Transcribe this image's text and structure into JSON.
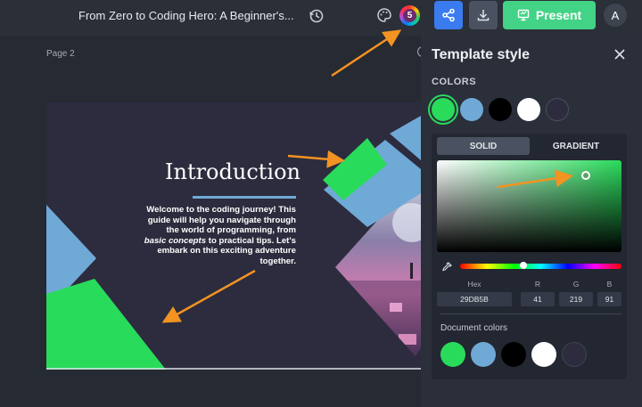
{
  "topbar": {
    "doc_title": "From Zero to Coding Hero: A Beginner's...",
    "color_badge": "5",
    "present_label": "Present",
    "avatar_initial": "A"
  },
  "canvas": {
    "page_label": "Page 2",
    "slide": {
      "title": "Introduction",
      "body_pre": "Welcome to the coding journey! This guide will help you navigate through the world of programming, from ",
      "body_em": "basic concepts",
      "body_post": " to practical tips. Let's embark on this exciting adventure together."
    }
  },
  "panel": {
    "title": "Template style",
    "colors_label": "COLORS",
    "swatches": [
      "#29db5b",
      "#6fa9d6",
      "#000000",
      "#ffffff",
      "#2c2c3e"
    ],
    "tabs": {
      "solid": "SOLID",
      "gradient": "GRADIENT"
    },
    "fields": {
      "hex_label": "Hex",
      "hex": "29DB5B",
      "r_label": "R",
      "r": "41",
      "g_label": "G",
      "g": "219",
      "b_label": "B",
      "b": "91"
    },
    "doc_colors_label": "Document colors",
    "doc_colors": [
      "#29db5b",
      "#6fa9d6",
      "#000000",
      "#ffffff",
      "#2c2c3e"
    ]
  },
  "colors": {
    "accent_green": "#43d386",
    "share_blue": "#3a7bf0",
    "annotation_orange": "#f39321"
  }
}
